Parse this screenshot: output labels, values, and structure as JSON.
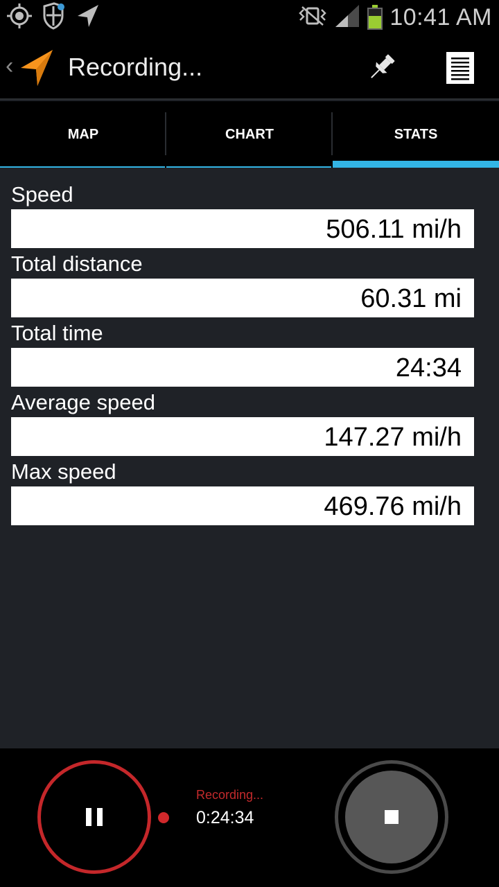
{
  "status_bar": {
    "time": "10:41 AM",
    "icons": [
      "gps-target-icon",
      "shield-icon",
      "navigation-arrow-icon",
      "vibrate-icon",
      "signal-icon",
      "battery-icon"
    ]
  },
  "action_bar": {
    "title": "Recording...",
    "back_glyph": "‹",
    "icons": [
      "app-navigation-icon",
      "pin-icon",
      "menu-icon"
    ],
    "accent_color": "#f7941d"
  },
  "tabs": [
    {
      "label": "MAP",
      "active": false
    },
    {
      "label": "CHART",
      "active": false
    },
    {
      "label": "STATS",
      "active": true
    }
  ],
  "tab_accent_color": "#33b5e5",
  "stats": [
    {
      "label": "Speed",
      "value": "506.11 mi/h"
    },
    {
      "label": "Total distance",
      "value": "60.31 mi"
    },
    {
      "label": "Total time",
      "value": "24:34"
    },
    {
      "label": "Average speed",
      "value": "147.27 mi/h"
    },
    {
      "label": "Max speed",
      "value": "469.76 mi/h"
    }
  ],
  "controls": {
    "status": "Recording...",
    "elapsed": "0:24:34",
    "record_color": "#c4272a",
    "icons": [
      "pause-icon",
      "recording-dot-icon",
      "stop-icon"
    ]
  }
}
